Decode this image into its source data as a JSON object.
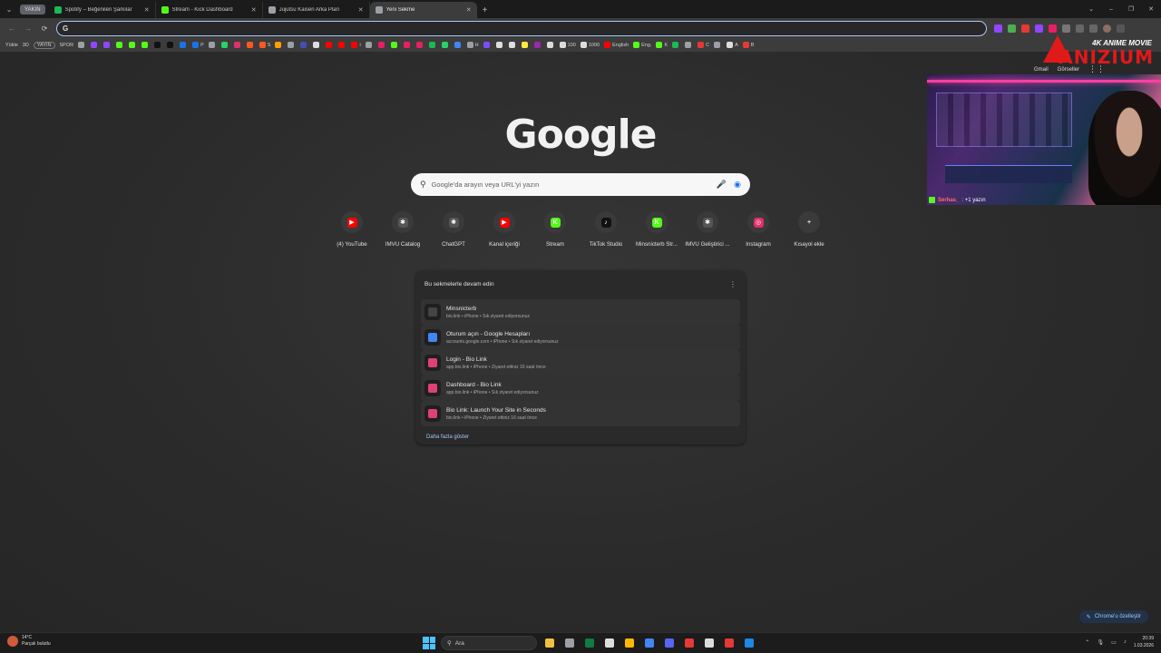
{
  "tabs": {
    "group_label": "YAKIN",
    "items": [
      {
        "title": "Spotify – Beğenilen Şarkılar",
        "color": "#1db954"
      },
      {
        "title": "Stream - Kick Dashboard",
        "color": "#53fc18"
      },
      {
        "title": "Jujutsu Kaisen Arka Plan",
        "color": "#9aa0a6"
      },
      {
        "title": "Yeni Sekme",
        "color": "#9aa0a6"
      }
    ],
    "new_tab": "+",
    "window_controls": [
      "⌄",
      "–",
      "❐",
      "✕"
    ]
  },
  "toolbar": {
    "back": "←",
    "forward": "→",
    "reload": "⟳",
    "omnibox_icon": "G",
    "omnibox_value": ""
  },
  "bookmarks": [
    {
      "label": "Yükle",
      "style": "text"
    },
    {
      "label": "3D",
      "style": "text"
    },
    {
      "label": "YAYIN",
      "style": "boxed"
    },
    {
      "label": "SPOR",
      "style": "text"
    },
    {
      "label": "",
      "color": "#9aa0a6"
    },
    {
      "label": "",
      "color": "#9146ff"
    },
    {
      "label": "",
      "color": "#9146ff"
    },
    {
      "label": "",
      "color": "#53fc18"
    },
    {
      "label": "",
      "color": "#53fc18"
    },
    {
      "label": "",
      "color": "#53fc18"
    },
    {
      "label": "",
      "color": "#111"
    },
    {
      "label": "",
      "color": "#111"
    },
    {
      "label": "",
      "color": "#1a73e8"
    },
    {
      "label": "P",
      "color": "#1a73e8"
    },
    {
      "label": "",
      "color": "#9aa0a6"
    },
    {
      "label": "",
      "color": "#25d366"
    },
    {
      "label": "",
      "color": "#e1306c"
    },
    {
      "label": "",
      "color": "#ff5722"
    },
    {
      "label": "S",
      "color": "#ff5722"
    },
    {
      "label": "",
      "color": "#ffa000"
    },
    {
      "label": "",
      "color": "#9aa0a6"
    },
    {
      "label": "",
      "color": "#3f51b5"
    },
    {
      "label": "",
      "color": "#ddd"
    },
    {
      "label": "",
      "color": "#ff0000"
    },
    {
      "label": "",
      "color": "#ff0000"
    },
    {
      "label": "i",
      "color": "#ff0000"
    },
    {
      "label": "",
      "color": "#9aa0a6"
    },
    {
      "label": "",
      "color": "#e91e63"
    },
    {
      "label": "",
      "color": "#53fc18"
    },
    {
      "label": "",
      "color": "#e91e63"
    },
    {
      "label": "",
      "color": "#e91e63"
    },
    {
      "label": "",
      "color": "#1db954"
    },
    {
      "label": "",
      "color": "#25d366"
    },
    {
      "label": "",
      "color": "#4285f4"
    },
    {
      "label": "H",
      "color": "#9aa0a6"
    },
    {
      "label": "",
      "color": "#7c4dff"
    },
    {
      "label": "",
      "color": "#ddd"
    },
    {
      "label": "",
      "color": "#ddd"
    },
    {
      "label": "",
      "color": "#ffeb3b"
    },
    {
      "label": "",
      "color": "#9c27b0"
    },
    {
      "label": "",
      "color": "#ddd"
    },
    {
      "label": "100",
      "color": "#ddd"
    },
    {
      "label": "1000",
      "color": "#ddd"
    },
    {
      "label": "English",
      "color": "#ff0000"
    },
    {
      "label": "Eng.",
      "color": "#53fc18"
    },
    {
      "label": "K",
      "color": "#53fc18"
    },
    {
      "label": "",
      "color": "#1db954"
    },
    {
      "label": "",
      "color": "#9aa0a6"
    },
    {
      "label": "C",
      "color": "#e53935"
    },
    {
      "label": "",
      "color": "#9aa0a6"
    },
    {
      "label": "A",
      "color": "#ddd"
    },
    {
      "label": "B",
      "color": "#e53935"
    }
  ],
  "ntp": {
    "logo": "Google",
    "top_links": [
      "Gmail",
      "Görseller"
    ],
    "search_placeholder": "Google'da arayın veya URL'yi yazın",
    "shortcuts": [
      {
        "label": "(4) YouTube",
        "glyph": "▶",
        "color": "#ff0000"
      },
      {
        "label": "IMVU Catalog",
        "glyph": "✱",
        "color": "#555"
      },
      {
        "label": "ChatGPT",
        "glyph": "✺",
        "color": "#555"
      },
      {
        "label": "Kanal içeriği",
        "glyph": "▶",
        "color": "#ff0000"
      },
      {
        "label": "Stream",
        "glyph": "K",
        "color": "#53fc18"
      },
      {
        "label": "TikTok Studio",
        "glyph": "♪",
        "color": "#111"
      },
      {
        "label": "Minsnicterb Str...",
        "glyph": "K",
        "color": "#53fc18"
      },
      {
        "label": "IMVU Geliştirici ...",
        "glyph": "✱",
        "color": "#555"
      },
      {
        "label": "Instagram",
        "glyph": "◎",
        "color": "#e1306c"
      },
      {
        "label": "Kısayol ekle",
        "glyph": "+",
        "color": "transparent"
      }
    ],
    "continue": {
      "heading": "Bu sekmelerle devam edin",
      "menu": "⋮",
      "items": [
        {
          "title": "Minsnicterb",
          "sub": "bio.link • iPhone • Sık ziyaret ediyorsunuz",
          "color": "#444"
        },
        {
          "title": "Oturum açın - Google Hesapları",
          "sub": "accounts.google.com • iPhone • Sık ziyaret ediyorsunuz",
          "color": "#4285f4"
        },
        {
          "title": "Login - Bio Link",
          "sub": "app.bio.link • iPhone • Ziyaret ettiniz 16 saat önce",
          "color": "#e0407a"
        },
        {
          "title": "Dashboard - Bio Link",
          "sub": "app.bio.link • iPhone • Sık ziyaret ediyorsunuz",
          "color": "#e0407a"
        },
        {
          "title": "Bio Link: Launch Your Site in Seconds",
          "sub": "bio.link • iPhone • Ziyaret ettiniz 16 saat önce",
          "color": "#e0407a"
        }
      ],
      "more": "Daha fazla göster"
    },
    "customize": "Chrome'u özelleştir"
  },
  "overlay": {
    "brand_top": "4K ANIME MOVIE",
    "brand_main": "ANIZIUM",
    "chat_user": "Serhas_",
    "chat_text": ": +1 yazın"
  },
  "taskbar": {
    "weather_temp": "14°C",
    "weather_desc": "Parçalı bulutlu",
    "search_label": "Ara",
    "apps": [
      "#f0c040",
      "#9aa0a6",
      "#107c41",
      "#ddd",
      "#ffb900",
      "#4285f4",
      "#5865f2",
      "#e53935",
      "#ddd",
      "#e53935",
      "#1e88e5"
    ],
    "time": "20:39",
    "date": "1.03.2026"
  },
  "colors": {
    "accent": "#a8c7fa",
    "kick_green": "#53fc18"
  }
}
